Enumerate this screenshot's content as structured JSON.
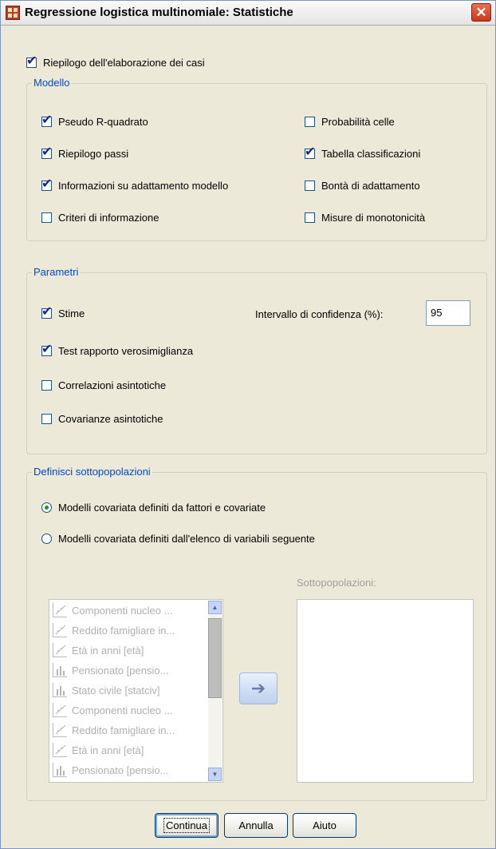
{
  "window": {
    "title": "Regressione logistica multinomiale: Statistiche",
    "close_label": "✕"
  },
  "top": {
    "case_summary": {
      "label": "Riepilogo dell'elaborazione dei casi",
      "checked": true
    }
  },
  "model": {
    "legend": "Modello",
    "options": [
      {
        "label": "Pseudo R-quadrato",
        "checked": true
      },
      {
        "label": "Riepilogo passi",
        "checked": true
      },
      {
        "label": "Informazioni su adattamento modello",
        "checked": true
      },
      {
        "label": "Criteri di informazione",
        "checked": false
      },
      {
        "label": "Probabilità celle",
        "checked": false
      },
      {
        "label": "Tabella classificazioni",
        "checked": true
      },
      {
        "label": "Bontà di adattamento",
        "checked": false
      },
      {
        "label": "Misure di monotonicità",
        "checked": false
      }
    ]
  },
  "parameters": {
    "legend": "Parametri",
    "options": [
      {
        "label": "Stime",
        "checked": true
      },
      {
        "label": "Test rapporto verosimiglianza",
        "checked": true
      },
      {
        "label": "Correlazioni asintotiche",
        "checked": false
      },
      {
        "label": "Covarianze asintotiche",
        "checked": false
      }
    ],
    "ci_label": "Intervallo di confidenza (%):",
    "ci_value": "95"
  },
  "subpopulations": {
    "legend": "Definisci sottopopolazioni",
    "radios": [
      {
        "label": "Modelli covariata definiti da fattori e covariate",
        "checked": true
      },
      {
        "label": "Modelli covariata definiti dall'elenco di variabili seguente",
        "checked": false
      }
    ],
    "target_label": "Sottopopolazioni:",
    "variables": [
      {
        "label": "Componenti nucleo ...",
        "icon": "scale-icon"
      },
      {
        "label": "Reddito famigliare in...",
        "icon": "scale-icon"
      },
      {
        "label": "Età in anni [età]",
        "icon": "scale-icon"
      },
      {
        "label": "Pensionato [pensio...",
        "icon": "ordinal-icon"
      },
      {
        "label": "Stato civile [statciv]",
        "icon": "ordinal-icon"
      },
      {
        "label": "Componenti nucleo ...",
        "icon": "scale-icon"
      },
      {
        "label": "Reddito famigliare in...",
        "icon": "scale-icon"
      },
      {
        "label": "Età in anni [età]",
        "icon": "scale-icon"
      },
      {
        "label": "Pensionato [pensio...",
        "icon": "ordinal-icon"
      }
    ]
  },
  "buttons": {
    "continue": "Continua",
    "cancel": "Annulla",
    "help": "Aiuto"
  }
}
